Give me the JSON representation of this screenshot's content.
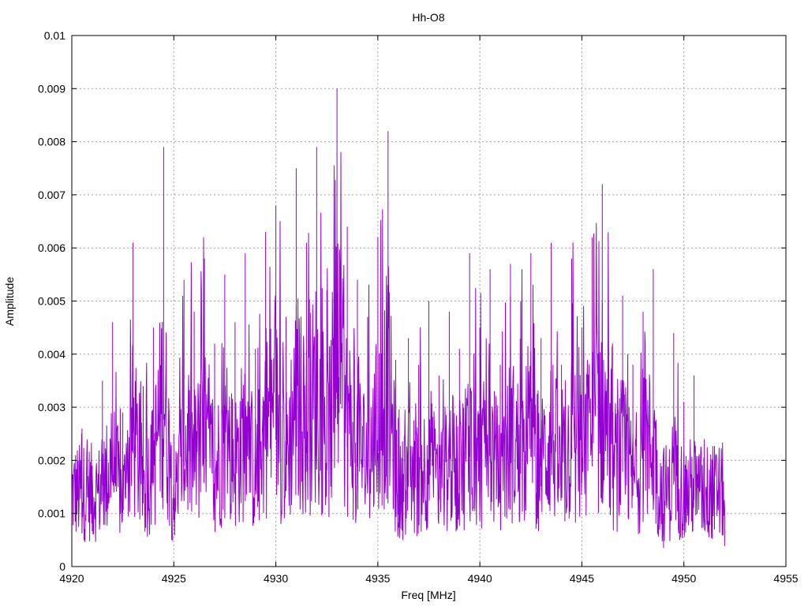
{
  "chart_data": {
    "type": "line",
    "title": "Hh-O8",
    "xlabel": "Freq [MHz]",
    "ylabel": "Amplitude",
    "xlim": [
      4920,
      4955
    ],
    "ylim": [
      0,
      0.01
    ],
    "xticks": [
      "4920",
      "4925",
      "4930",
      "4935",
      "4940",
      "4945",
      "4950",
      "4955"
    ],
    "yticks": [
      "0",
      "0.001",
      "0.002",
      "0.003",
      "0.004",
      "0.005",
      "0.006",
      "0.007",
      "0.008",
      "0.009",
      "0.01"
    ],
    "grid": true,
    "legend": "none",
    "series": [
      {
        "color": "#9400d3",
        "x": [
          4920.0,
          4920.5,
          4921.0,
          4921.5,
          4922.0,
          4922.5,
          4923.0,
          4923.5,
          4924.0,
          4924.5,
          4925.0,
          4925.5,
          4926.0,
          4926.5,
          4927.0,
          4927.5,
          4928.0,
          4928.5,
          4929.0,
          4929.5,
          4930.0,
          4930.5,
          4931.0,
          4931.5,
          4932.0,
          4932.5,
          4933.0,
          4933.5,
          4934.0,
          4934.5,
          4935.0,
          4935.5,
          4936.0,
          4936.5,
          4937.0,
          4937.5,
          4938.0,
          4938.5,
          4939.0,
          4939.5,
          4940.0,
          4940.5,
          4941.0,
          4941.5,
          4942.0,
          4942.5,
          4943.0,
          4943.5,
          4944.0,
          4944.5,
          4945.0,
          4945.5,
          4946.0,
          4946.5,
          4947.0,
          4947.5,
          4948.0,
          4948.5,
          4949.0,
          4949.5,
          4950.0,
          4950.5,
          4951.0,
          4951.5,
          4952.0
        ],
        "y": [
          0.0001,
          0.0026,
          0.0019,
          0.0035,
          0.0046,
          0.0029,
          0.0061,
          0.0034,
          0.0045,
          0.0079,
          0.0025,
          0.0054,
          0.0048,
          0.0058,
          0.0042,
          0.0055,
          0.0046,
          0.0059,
          0.0041,
          0.0063,
          0.0068,
          0.0047,
          0.0075,
          0.0061,
          0.0079,
          0.0052,
          0.009,
          0.0064,
          0.0054,
          0.0047,
          0.0062,
          0.0082,
          0.0028,
          0.0043,
          0.0038,
          0.005,
          0.0036,
          0.0048,
          0.0041,
          0.0059,
          0.0045,
          0.0056,
          0.0038,
          0.0057,
          0.005,
          0.0059,
          0.0043,
          0.0061,
          0.0038,
          0.0058,
          0.0045,
          0.0062,
          0.0072,
          0.0042,
          0.0051,
          0.0038,
          0.0048,
          0.0056,
          0.001,
          0.0044,
          0.0031,
          0.0036,
          0.0024,
          0.002,
          0.0011
        ]
      }
    ]
  }
}
